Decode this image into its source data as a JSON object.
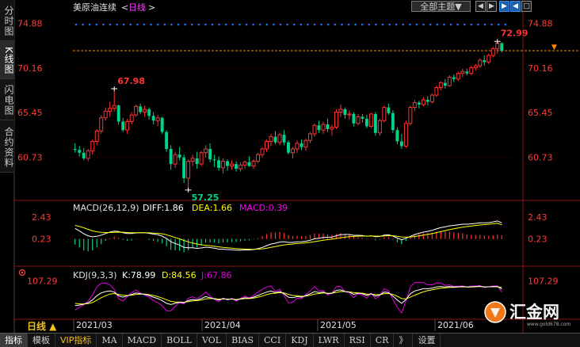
{
  "header": {
    "symbol": "美原油连续",
    "period_prefix": "<",
    "period": "日线",
    "period_suffix": ">"
  },
  "left_tabs": [
    "分时图",
    "K线图",
    "闪电图",
    "合约资料"
  ],
  "toolbar": {
    "theme_label": "全部主题▼",
    "buttons": [
      "◀",
      "▶",
      "▶",
      "◀",
      "□"
    ]
  },
  "indicators": {
    "macd": {
      "name": "MACD(26,12,9)",
      "diff": "DIFF:1.86",
      "dea": "DEA:1.66",
      "macd": "MACD:0.39"
    },
    "kdj": {
      "name": "KDJ(9,3,3)",
      "k": "K:78.99",
      "d": "D:84.56",
      "j": "J:67.86"
    }
  },
  "price_axis": [
    "74.88",
    "70.16",
    "65.45",
    "60.73"
  ],
  "macd_axis": [
    "2.43",
    "0.23"
  ],
  "kdj_axis": [
    "107.29"
  ],
  "annotations": {
    "high": "67.98",
    "low": "57.25",
    "last_high": "72.99"
  },
  "x_axis": {
    "period_label": "日线 ▲",
    "months": [
      "2021/03",
      "2021/04",
      "2021/05",
      "2021/06"
    ]
  },
  "bottom_tabs": [
    "指标",
    "模板",
    "VIP指标",
    "MA",
    "MACD",
    "BOLL",
    "VOL",
    "BIAS",
    "CCI",
    "KDJ",
    "LWR",
    "RSI",
    "CR",
    "》",
    "设置"
  ],
  "logo": {
    "text": "汇金网",
    "url": "www.gold678.com"
  },
  "colors": {
    "up": "#ff3232",
    "down": "#00d28c",
    "diff": "#ffffff",
    "dea": "#ffff00",
    "macd": "#ff00ff",
    "k": "#ffffff",
    "d": "#ffff00",
    "j": "#e000e0",
    "axis_text": "#ff3c3c",
    "dots": "#2070ff",
    "current_line": "#ff8800"
  },
  "chart_data": {
    "type": "candlestick",
    "title": "美原油连续 日线",
    "y_range": [
      56.4,
      76.2
    ],
    "current_price": 72.0,
    "max_point": {
      "value": 67.98,
      "label": "67.98"
    },
    "min_point": {
      "value": 57.25,
      "label": "57.25"
    },
    "recent_high": {
      "value": 72.99,
      "label": "72.99"
    },
    "candles": [
      [
        61.6,
        62.2,
        61.2,
        61.5
      ],
      [
        61.5,
        61.9,
        60.8,
        61.2
      ],
      [
        61.2,
        61.7,
        60.4,
        60.6
      ],
      [
        60.6,
        61.6,
        60.3,
        61.4
      ],
      [
        61.4,
        62.6,
        61.0,
        62.4
      ],
      [
        62.4,
        63.7,
        62.0,
        63.5
      ],
      [
        63.5,
        65.2,
        63.2,
        64.9
      ],
      [
        64.9,
        66.0,
        64.6,
        65.6
      ],
      [
        65.6,
        66.6,
        65.0,
        65.9
      ],
      [
        65.9,
        67.98,
        65.6,
        66.2
      ],
      [
        66.2,
        66.3,
        64.2,
        64.5
      ],
      [
        64.5,
        64.9,
        63.4,
        63.6
      ],
      [
        63.6,
        64.8,
        63.2,
        64.5
      ],
      [
        64.5,
        65.5,
        64.2,
        65.2
      ],
      [
        65.2,
        66.3,
        65.0,
        66.1
      ],
      [
        66.1,
        66.4,
        65.3,
        65.5
      ],
      [
        65.5,
        66.2,
        65.0,
        65.8
      ],
      [
        65.8,
        66.0,
        64.7,
        65.1
      ],
      [
        65.1,
        65.5,
        64.2,
        64.6
      ],
      [
        64.6,
        65.2,
        64.0,
        64.9
      ],
      [
        64.9,
        65.0,
        63.2,
        63.4
      ],
      [
        63.4,
        63.6,
        61.3,
        61.6
      ],
      [
        61.6,
        62.0,
        59.4,
        60.0
      ],
      [
        60.0,
        61.3,
        59.6,
        61.0
      ],
      [
        61.0,
        61.8,
        60.4,
        60.7
      ],
      [
        60.7,
        61.0,
        58.0,
        58.5
      ],
      [
        58.5,
        60.5,
        57.25,
        60.3
      ],
      [
        60.3,
        61.0,
        59.8,
        60.6
      ],
      [
        60.6,
        61.3,
        59.5,
        60.0
      ],
      [
        60.0,
        61.4,
        59.8,
        61.2
      ],
      [
        61.2,
        62.0,
        60.7,
        61.6
      ],
      [
        61.6,
        62.2,
        60.2,
        60.5
      ],
      [
        60.5,
        61.0,
        59.7,
        60.4
      ],
      [
        60.4,
        60.8,
        59.3,
        59.6
      ],
      [
        59.6,
        60.6,
        59.0,
        60.3
      ],
      [
        60.3,
        60.5,
        59.3,
        59.8
      ],
      [
        59.8,
        60.4,
        59.4,
        60.0
      ],
      [
        60.0,
        60.3,
        59.2,
        59.5
      ],
      [
        59.5,
        60.2,
        59.2,
        59.9
      ],
      [
        59.9,
        60.4,
        59.5,
        60.2
      ],
      [
        60.2,
        60.8,
        59.7,
        59.8
      ],
      [
        59.8,
        60.5,
        59.5,
        60.3
      ],
      [
        60.3,
        61.2,
        60.1,
        61.0
      ],
      [
        61.0,
        61.8,
        60.7,
        61.6
      ],
      [
        61.6,
        62.6,
        61.3,
        62.4
      ],
      [
        62.4,
        63.2,
        61.9,
        62.9
      ],
      [
        62.9,
        63.5,
        62.1,
        62.3
      ],
      [
        62.3,
        63.3,
        62.0,
        63.1
      ],
      [
        63.1,
        63.6,
        62.0,
        62.3
      ],
      [
        62.3,
        62.5,
        61.0,
        61.2
      ],
      [
        61.2,
        61.8,
        60.6,
        61.6
      ],
      [
        61.6,
        62.5,
        61.2,
        62.2
      ],
      [
        62.2,
        62.6,
        61.5,
        61.8
      ],
      [
        61.8,
        62.7,
        61.4,
        62.5
      ],
      [
        62.5,
        63.4,
        62.2,
        63.2
      ],
      [
        63.2,
        64.3,
        62.9,
        64.1
      ],
      [
        64.1,
        64.6,
        63.3,
        63.6
      ],
      [
        63.6,
        64.5,
        63.2,
        64.2
      ],
      [
        64.2,
        64.8,
        63.4,
        63.7
      ],
      [
        63.7,
        64.2,
        63.0,
        63.9
      ],
      [
        63.9,
        65.8,
        63.7,
        65.5
      ],
      [
        65.5,
        66.3,
        65.0,
        65.8
      ],
      [
        65.8,
        66.0,
        64.8,
        65.2
      ],
      [
        65.2,
        65.7,
        64.7,
        65.3
      ],
      [
        65.3,
        65.5,
        64.0,
        64.3
      ],
      [
        64.3,
        65.3,
        64.1,
        65.0
      ],
      [
        65.0,
        65.3,
        64.4,
        64.8
      ],
      [
        64.8,
        65.2,
        63.8,
        64.0
      ],
      [
        64.0,
        65.4,
        63.8,
        65.3
      ],
      [
        65.3,
        65.5,
        63.0,
        63.3
      ],
      [
        63.3,
        64.8,
        63.0,
        64.6
      ],
      [
        64.6,
        66.2,
        64.4,
        66.0
      ],
      [
        66.0,
        66.4,
        65.2,
        65.4
      ],
      [
        65.4,
        65.7,
        63.3,
        63.6
      ],
      [
        63.6,
        63.9,
        62.1,
        62.4
      ],
      [
        62.4,
        63.2,
        61.6,
        61.9
      ],
      [
        61.9,
        64.6,
        61.7,
        64.3
      ],
      [
        64.3,
        66.2,
        64.1,
        66.0
      ],
      [
        66.0,
        66.8,
        65.6,
        66.5
      ],
      [
        66.5,
        66.7,
        65.9,
        66.3
      ],
      [
        66.3,
        67.1,
        66.1,
        66.8
      ],
      [
        66.8,
        67.2,
        66.2,
        66.6
      ],
      [
        66.6,
        67.5,
        66.4,
        67.3
      ],
      [
        67.3,
        68.3,
        67.1,
        68.1
      ],
      [
        68.1,
        68.8,
        67.8,
        68.6
      ],
      [
        68.6,
        69.0,
        68.0,
        68.3
      ],
      [
        68.3,
        69.4,
        68.2,
        69.2
      ],
      [
        69.2,
        69.5,
        68.7,
        69.0
      ],
      [
        69.0,
        69.8,
        68.8,
        69.6
      ],
      [
        69.6,
        70.1,
        69.2,
        69.8
      ],
      [
        69.8,
        70.1,
        69.4,
        69.6
      ],
      [
        69.6,
        70.4,
        69.4,
        70.2
      ],
      [
        70.2,
        70.6,
        69.9,
        70.4
      ],
      [
        70.4,
        71.2,
        70.2,
        71.0
      ],
      [
        71.0,
        71.5,
        70.4,
        70.8
      ],
      [
        70.8,
        71.7,
        70.6,
        71.5
      ],
      [
        71.5,
        72.4,
        71.3,
        72.2
      ],
      [
        72.2,
        72.99,
        71.7,
        72.8
      ],
      [
        72.8,
        72.9,
        71.8,
        72.0
      ]
    ],
    "macd": {
      "range": [
        -2.2,
        3.4
      ],
      "diff": [
        1.3,
        1.05,
        0.75,
        0.55,
        0.45,
        0.5,
        0.62,
        0.78,
        0.92,
        1.02,
        0.98,
        0.86,
        0.78,
        0.78,
        0.85,
        0.86,
        0.86,
        0.8,
        0.72,
        0.66,
        0.52,
        0.28,
        -0.05,
        -0.22,
        -0.38,
        -0.62,
        -0.66,
        -0.66,
        -0.72,
        -0.68,
        -0.6,
        -0.64,
        -0.7,
        -0.8,
        -0.8,
        -0.84,
        -0.86,
        -0.9,
        -0.9,
        -0.88,
        -0.88,
        -0.84,
        -0.75,
        -0.62,
        -0.45,
        -0.28,
        -0.2,
        -0.08,
        -0.05,
        -0.12,
        -0.12,
        -0.06,
        -0.05,
        0.0,
        0.1,
        0.25,
        0.3,
        0.38,
        0.4,
        0.42,
        0.55,
        0.66,
        0.68,
        0.68,
        0.6,
        0.6,
        0.58,
        0.5,
        0.55,
        0.45,
        0.48,
        0.62,
        0.65,
        0.52,
        0.32,
        0.15,
        0.3,
        0.5,
        0.68,
        0.8,
        0.92,
        1.0,
        1.1,
        1.25,
        1.38,
        1.45,
        1.55,
        1.6,
        1.66,
        1.72,
        1.72,
        1.76,
        1.8,
        1.86,
        1.86,
        1.88,
        1.95,
        2.05,
        1.86
      ],
      "dea": [
        1.6,
        1.5,
        1.36,
        1.2,
        1.05,
        0.95,
        0.9,
        0.88,
        0.88,
        0.9,
        0.92,
        0.91,
        0.88,
        0.86,
        0.86,
        0.86,
        0.86,
        0.85,
        0.82,
        0.8,
        0.75,
        0.66,
        0.52,
        0.38,
        0.24,
        0.08,
        -0.06,
        -0.18,
        -0.28,
        -0.36,
        -0.41,
        -0.46,
        -0.51,
        -0.57,
        -0.62,
        -0.66,
        -0.7,
        -0.74,
        -0.77,
        -0.79,
        -0.81,
        -0.82,
        -0.8,
        -0.77,
        -0.71,
        -0.62,
        -0.54,
        -0.45,
        -0.37,
        -0.32,
        -0.28,
        -0.23,
        -0.2,
        -0.16,
        -0.11,
        -0.04,
        0.03,
        0.1,
        0.16,
        0.21,
        0.28,
        0.35,
        0.41,
        0.46,
        0.49,
        0.51,
        0.52,
        0.52,
        0.53,
        0.52,
        0.51,
        0.53,
        0.56,
        0.55,
        0.5,
        0.43,
        0.41,
        0.43,
        0.48,
        0.54,
        0.62,
        0.69,
        0.77,
        0.87,
        0.97,
        1.07,
        1.17,
        1.26,
        1.34,
        1.42,
        1.48,
        1.54,
        1.59,
        1.64,
        1.68,
        1.72,
        1.76,
        1.82,
        1.66
      ]
    },
    "kdj": {
      "range": [
        -20,
        115
      ],
      "k": [
        20,
        22,
        25,
        30,
        40,
        55,
        65,
        70,
        72,
        68,
        55,
        50,
        55,
        60,
        65,
        62,
        60,
        56,
        50,
        45,
        38,
        28,
        24,
        28,
        32,
        30,
        38,
        42,
        40,
        45,
        52,
        48,
        44,
        40,
        45,
        42,
        44,
        40,
        44,
        48,
        46,
        50,
        56,
        62,
        68,
        72,
        66,
        70,
        62,
        50,
        48,
        52,
        50,
        56,
        62,
        70,
        66,
        68,
        62,
        64,
        74,
        76,
        70,
        68,
        60,
        64,
        62,
        56,
        62,
        54,
        58,
        68,
        66,
        54,
        40,
        28,
        42,
        62,
        72,
        76,
        80,
        80,
        82,
        86,
        88,
        86,
        88,
        86,
        87,
        88,
        86,
        87,
        88,
        89,
        86,
        87,
        88,
        88,
        78.99
      ],
      "d": [
        28,
        26,
        26,
        27,
        31,
        39,
        48,
        55,
        61,
        63,
        60,
        57,
        56,
        57,
        60,
        61,
        61,
        59,
        56,
        52,
        47,
        41,
        35,
        33,
        33,
        32,
        34,
        37,
        38,
        40,
        44,
        45,
        45,
        43,
        44,
        43,
        43,
        42,
        43,
        45,
        45,
        47,
        50,
        54,
        59,
        63,
        64,
        66,
        65,
        60,
        56,
        55,
        53,
        54,
        57,
        61,
        63,
        65,
        64,
        64,
        67,
        70,
        70,
        69,
        66,
        65,
        64,
        61,
        61,
        59,
        59,
        62,
        63,
        60,
        53,
        45,
        44,
        50,
        57,
        63,
        69,
        73,
        76,
        79,
        82,
        83,
        85,
        85,
        86,
        87,
        86,
        86,
        87,
        88,
        87,
        87,
        87,
        87,
        84.56
      ],
      "j": [
        4,
        14,
        23,
        36,
        58,
        87,
        99,
        100,
        94,
        78,
        45,
        36,
        53,
        66,
        75,
        64,
        58,
        50,
        38,
        31,
        20,
        2,
        2,
        18,
        30,
        26,
        46,
        52,
        44,
        55,
        68,
        54,
        42,
        34,
        47,
        40,
        46,
        36,
        46,
        54,
        48,
        56,
        68,
        78,
        86,
        90,
        70,
        78,
        56,
        30,
        32,
        46,
        44,
        60,
        72,
        88,
        72,
        74,
        58,
        64,
        88,
        88,
        70,
        66,
        48,
        62,
        58,
        46,
        64,
        44,
        56,
        80,
        72,
        42,
        14,
        -6,
        38,
        86,
        102,
        102,
        102,
        94,
        94,
        100,
        100,
        92,
        94,
        88,
        89,
        90,
        86,
        89,
        90,
        91,
        84,
        87,
        90,
        90,
        67.86
      ]
    }
  }
}
